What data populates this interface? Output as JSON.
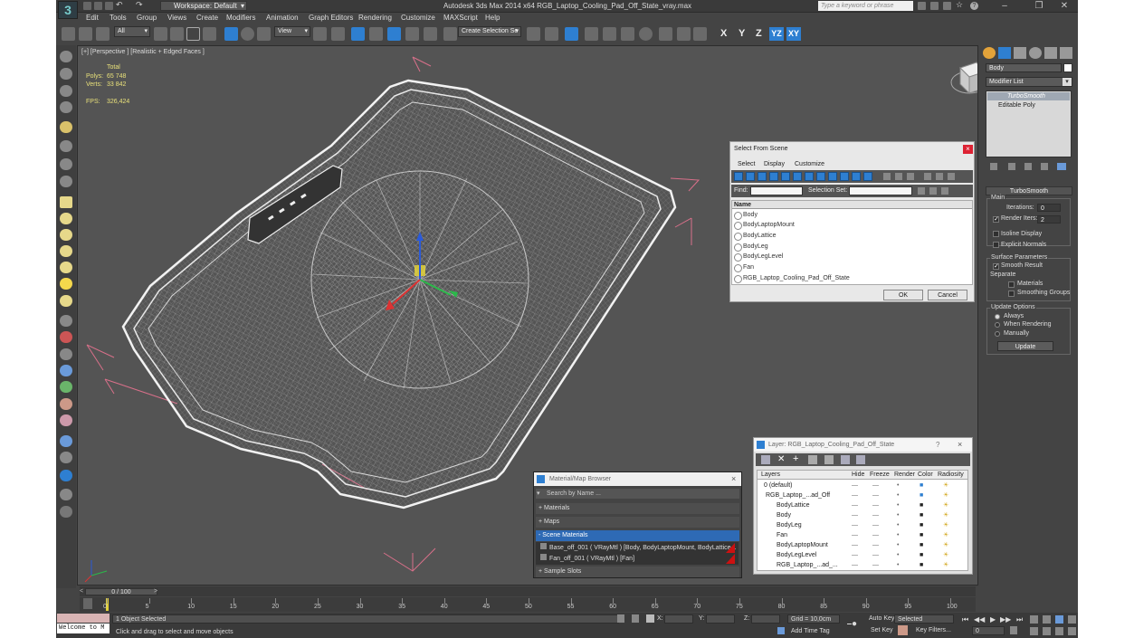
{
  "app": {
    "window_title": "Autodesk 3ds Max  2014 x64    RGB_Laptop_Cooling_Pad_Off_State_vray.max",
    "workspace": "Workspace: Default",
    "search_placeholder": "Type a keyword or phrase",
    "menu": [
      "Edit",
      "Tools",
      "Group",
      "Views",
      "Create",
      "Modifiers",
      "Animation",
      "Graph Editors",
      "Rendering",
      "Customize",
      "MAXScript",
      "Help"
    ]
  },
  "toolbar": {
    "selection_filter": "All",
    "ref_coord": "View",
    "named_selection": "Create Selection Se",
    "axis_labels": [
      "X",
      "Y",
      "Z",
      "YZ",
      "XY"
    ]
  },
  "viewport": {
    "label": "[+] [Perspective ] [Realistic + Edged Faces ]",
    "stats": {
      "total_label": "Total",
      "polys_label": "Polys:",
      "polys_value": "65 748",
      "verts_label": "Verts:",
      "verts_value": "33 842",
      "fps_label": "FPS:",
      "fps_value": "326,424"
    }
  },
  "command_panel": {
    "object_name": "Body",
    "modifier_list_label": "Modifier List",
    "stack": [
      "TurboSmooth",
      "Editable Poly"
    ],
    "rollout_title": "TurboSmooth",
    "main_label": "Main",
    "iterations_label": "Iterations:",
    "iterations_value": "0",
    "render_iters_label": "Render Iters:",
    "render_iters_value": "2",
    "isoline_label": "Isoline Display",
    "explicit_normals_label": "Explicit Normals",
    "surface_params_label": "Surface Parameters",
    "smooth_result_label": "Smooth Result",
    "separate_label": "Separate",
    "materials_label": "Materials",
    "smoothing_groups_label": "Smoothing Groups",
    "update_options_label": "Update Options",
    "always_label": "Always",
    "when_rendering_label": "When Rendering",
    "manually_label": "Manually",
    "update_button": "Update"
  },
  "select_dialog": {
    "title": "Select From Scene",
    "menus": [
      "Select",
      "Display",
      "Customize"
    ],
    "find_label": "Find:",
    "selection_set_label": "Selection Set:",
    "column_header": "Name",
    "items": [
      "Body",
      "BodyLaptopMount",
      "BodyLattice",
      "BodyLeg",
      "BodyLegLevel",
      "Fan",
      "RGB_Laptop_Cooling_Pad_Off_State"
    ],
    "ok": "OK",
    "cancel": "Cancel"
  },
  "material_browser": {
    "title": "Material/Map Browser",
    "search_placeholder": "Search by Name ...",
    "sections": [
      "+ Materials",
      "+ Maps",
      "- Scene Materials",
      "+ Sample Slots"
    ],
    "materials": [
      "Base_off_001  ( VRayMtl ) [Body, BodyLaptopMount, BodyLattice...",
      "Fan_off_001  ( VRayMtl ) [Fan]"
    ]
  },
  "layer_dialog": {
    "title": "Layer: RGB_Laptop_Cooling_Pad_Off_State",
    "columns": [
      "Layers",
      "Hide",
      "Freeze",
      "Render",
      "Color",
      "Radiosity"
    ],
    "rows": [
      "0 (default)",
      "RGB_Laptop_...ad_Off",
      "BodyLattice",
      "Body",
      "BodyLeg",
      "Fan",
      "BodyLaptopMount",
      "BodyLegLevel",
      "RGB_Laptop_...ad_..."
    ]
  },
  "timeline": {
    "frame_display": "0 / 100",
    "ticks": [
      "0",
      "5",
      "10",
      "15",
      "20",
      "25",
      "30",
      "35",
      "40",
      "45",
      "50",
      "55",
      "60",
      "65",
      "70",
      "75",
      "80",
      "85",
      "90",
      "95",
      "100"
    ]
  },
  "status": {
    "maxscript_listener": "Welcome to M",
    "selection": "1 Object Selected",
    "prompt": "Click and drag to select and move objects",
    "x_label": "X:",
    "y_label": "Y:",
    "z_label": "Z:",
    "grid": "Grid = 10,0cm",
    "add_time_tag": "Add Time Tag",
    "auto_key": "Auto Key",
    "set_key": "Set Key",
    "key_mode": "Selected",
    "key_filters": "Key Filters...",
    "current_frame": "0"
  },
  "colors": {
    "accent": "#2e7fd1",
    "wireframe": "#e8e8e8",
    "selection_box": "#d9708a"
  }
}
